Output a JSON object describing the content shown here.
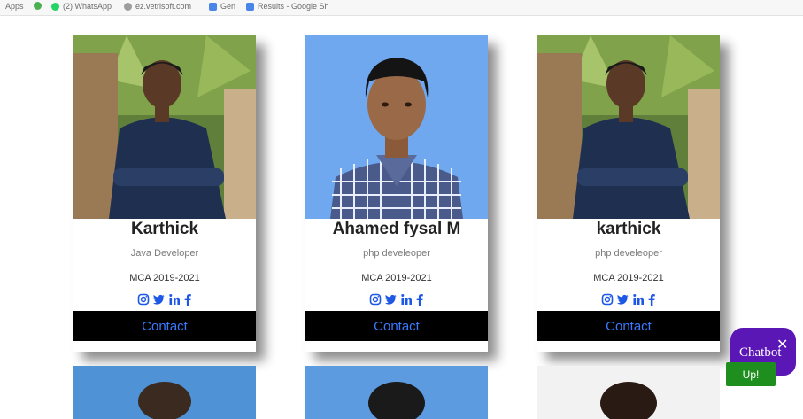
{
  "bookmarks_bar": {
    "items": [
      {
        "label": "Apps",
        "icon": "apps-grid-icon"
      },
      {
        "label": "",
        "icon": "circle-icon"
      },
      {
        "label": "(2) WhatsApp",
        "icon": "whatsapp-icon"
      },
      {
        "label": "ez.vetrisoft.com",
        "icon": "globe-icon"
      },
      {
        "label": "Gen",
        "icon": "doc-icon"
      },
      {
        "label": "Results - Google Sh",
        "icon": "doc-icon"
      }
    ]
  },
  "cards": [
    {
      "name": "Karthick",
      "role": "Java Developer",
      "education": "MCA 2019-2021",
      "contact_label": "Contact",
      "photo": "person-outdoor-photo"
    },
    {
      "name": "Ahamed fysal M",
      "role": "php develeoper",
      "education": "MCA 2019-2021",
      "contact_label": "Contact",
      "photo": "person-passport-photo"
    },
    {
      "name": "karthick",
      "role": "php develeoper",
      "education": "MCA 2019-2021",
      "contact_label": "Contact",
      "photo": "person-outdoor-photo"
    }
  ],
  "social_icons": [
    "instagram-icon",
    "twitter-icon",
    "linkedin-icon",
    "facebook-icon"
  ],
  "chatbot": {
    "label": "Chatbot",
    "close": "✕"
  },
  "up_button": {
    "label": "Up!"
  },
  "colors": {
    "contact_bg": "#000000",
    "contact_text": "#3a78ff",
    "social": "#1c57e6",
    "chatbot_bg": "#5a17b5",
    "up_bg": "#1e8e1e"
  }
}
